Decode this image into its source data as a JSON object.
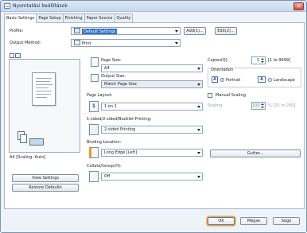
{
  "window": {
    "title": "Nyomtatási beállítások",
    "close_glyph": "✕"
  },
  "tabs": [
    {
      "label": "Basic Settings",
      "active": true
    },
    {
      "label": "Page Setup",
      "active": false
    },
    {
      "label": "Finishing",
      "active": false
    },
    {
      "label": "Paper Source",
      "active": false
    },
    {
      "label": "Quality",
      "active": false
    }
  ],
  "profile": {
    "label": "Profile:",
    "value": "Default Settings",
    "add_button": "Add(1)...",
    "edit_button": "Edit(2)..."
  },
  "output_method": {
    "label": "Output Method:",
    "value": "Print"
  },
  "preview": {
    "status": "A4 [Scaling: Auto]",
    "view_settings_button": "View Settings",
    "restore_defaults_button": "Restore Defaults"
  },
  "page_size": {
    "label": "Page Size:",
    "value": "A4"
  },
  "output_size": {
    "label": "Output Size:",
    "value": "Match Page Size"
  },
  "page_layout": {
    "label": "Page Layout:",
    "value": "1 on 1",
    "icon_text": "1"
  },
  "sided": {
    "label": "1-sided/2-sided/Booklet Printing:",
    "value": "2-sided Printing"
  },
  "binding": {
    "label": "Binding Location:",
    "value": "Long Edge [Left]",
    "gutter_button": "Gutter..."
  },
  "collate": {
    "label": "Collate/Group(H):",
    "value": "Off"
  },
  "copies": {
    "label": "Copies(Q):",
    "value": "1",
    "range": "[1 to 9999]"
  },
  "orientation": {
    "label": "Orientation",
    "portrait": "Portrait",
    "landscape": "Landscape",
    "selected": "Portrait"
  },
  "manual_scaling": {
    "label": "Manual Scaling",
    "checked": false,
    "scaling_label": "Scaling:",
    "value": "100",
    "range": "% [25 to 200]"
  },
  "footer": {
    "ok": "OK",
    "cancel": "Mégse",
    "help": "Súgó"
  }
}
